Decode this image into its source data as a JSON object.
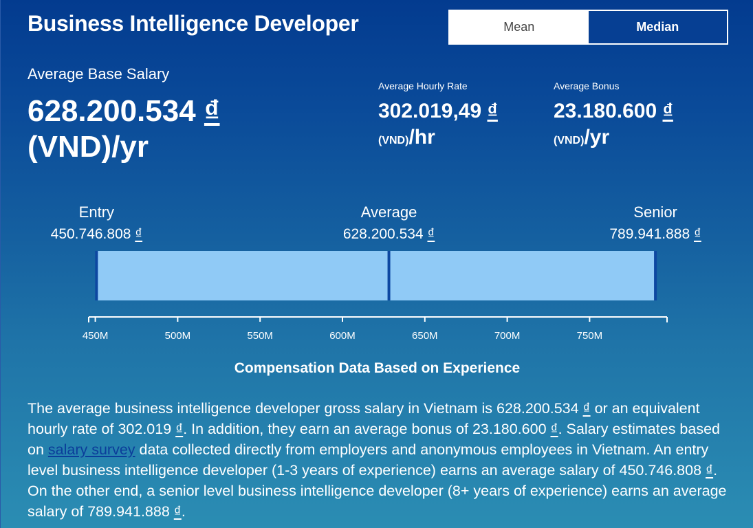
{
  "header": {
    "title": "Business Intelligence Developer",
    "toggle": {
      "mean_label": "Mean",
      "median_label": "Median",
      "selected": "Median"
    }
  },
  "base_salary": {
    "label": "Average Base Salary",
    "value": "628.200.534",
    "currency_symbol": "₫",
    "unit": "(VND)/yr"
  },
  "hourly_rate": {
    "label": "Average Hourly Rate",
    "value": "302.019,49",
    "currency_symbol": "₫",
    "unit_prefix": "(VND)",
    "unit_suffix": "/hr"
  },
  "bonus": {
    "label": "Average Bonus",
    "value": "23.180.600",
    "currency_symbol": "₫",
    "unit_prefix": "(VND)",
    "unit_suffix": "/yr"
  },
  "levels": [
    {
      "name": "Entry",
      "amount": "450.746.808",
      "symbol": "₫"
    },
    {
      "name": "Average",
      "amount": "628.200.534",
      "symbol": "₫"
    },
    {
      "name": "Senior",
      "amount": "789.941.888",
      "symbol": "₫"
    }
  ],
  "chart_data": {
    "type": "bar",
    "title": "Compensation Data Based on Experience",
    "orientation": "horizontal-range",
    "series": [
      {
        "name": "Entry",
        "value": 450746808
      },
      {
        "name": "Average",
        "value": 628200534
      },
      {
        "name": "Senior",
        "value": 789941888
      }
    ],
    "xlim": [
      446000000,
      797000000
    ],
    "xticks": [
      450000000,
      500000000,
      550000000,
      600000000,
      650000000,
      700000000,
      750000000
    ],
    "xtick_labels": [
      "450M",
      "500M",
      "550M",
      "600M",
      "650M",
      "700M",
      "750M"
    ],
    "xlabel": "",
    "ylabel": "",
    "grid": false,
    "colors": {
      "bar_fill": "#90caf6",
      "marker": "#0d47a1",
      "axis": "#ffffff"
    }
  },
  "description": {
    "part1": "The average business intelligence developer gross salary in Vietnam is 628.200.534 ",
    "sym1": "₫",
    "part2": " or an equivalent hourly rate of 302.019 ",
    "sym2": "₫",
    "part3": ". In addition, they earn an average bonus of 23.180.600 ",
    "sym3": "₫",
    "part4": ". Salary estimates based on ",
    "link_text": "salary survey",
    "part5": " data collected directly from employers and anonymous employees in Vietnam. An entry level business intelligence developer (1-3 years of experience) earns an average salary of 450.746.808 ",
    "sym4": "₫",
    "part6": ". On the other end, a senior level business intelligence developer (8+ years of experience) earns an average salary of 789.941.888 ",
    "sym5": "₫",
    "part7": "."
  }
}
